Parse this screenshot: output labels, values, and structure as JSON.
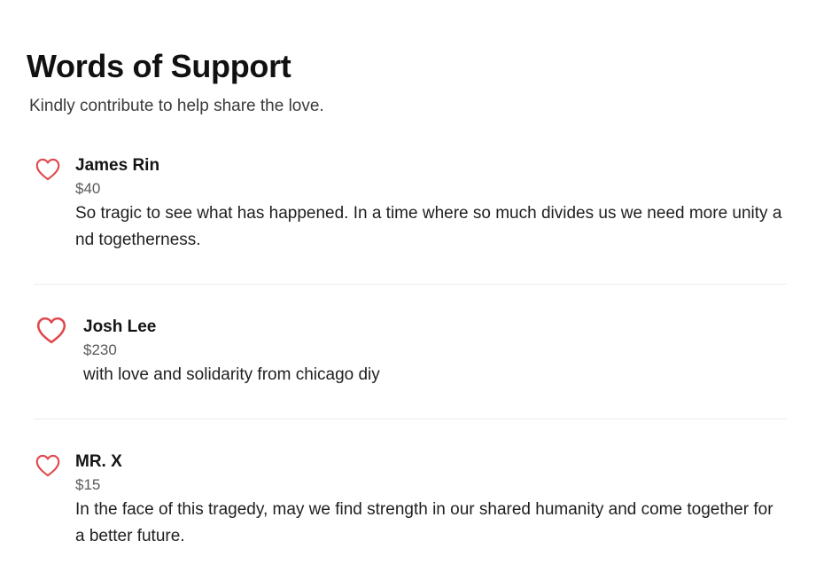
{
  "header": {
    "title": "Words of Support",
    "subtitle": "Kindly contribute to help share the love."
  },
  "colors": {
    "heart": "#e0474c",
    "divider": "#ececec"
  },
  "entries": [
    {
      "name": "James Rin",
      "amount": "$40",
      "message": "So tragic to see what has happened. In a time where so much divides us we need more unity and togetherness.",
      "icon": "heart-outline-icon"
    },
    {
      "name": "Josh Lee",
      "amount": "$230",
      "message": "with love and solidarity from chicago diy",
      "icon": "heart-outline-icon"
    },
    {
      "name": "MR. X",
      "amount": "$15",
      "message": "In the face of this tragedy, may we find strength in our shared humanity and come together for a better future.",
      "icon": "heart-outline-icon"
    }
  ]
}
